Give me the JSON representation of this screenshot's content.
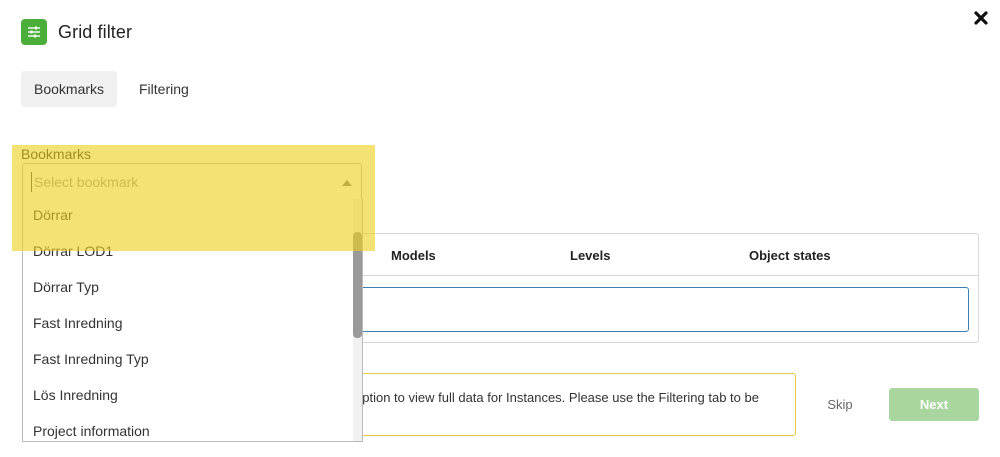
{
  "dialog": {
    "title": "Grid filter",
    "header_icon": "sliders-icon",
    "close_icon": "close-icon"
  },
  "tabs": [
    {
      "label": "Bookmarks",
      "active": true
    },
    {
      "label": "Filtering",
      "active": false
    }
  ],
  "bookmarks": {
    "label": "Bookmarks",
    "placeholder": "Select bookmark",
    "options": [
      "Dörrar",
      "Dörrar LOD1",
      "Dörrar Typ",
      "Fast Inredning",
      "Fast Inredning Typ",
      "Lös Inredning",
      "Project information"
    ]
  },
  "grid": {
    "columns": [
      "Models",
      "Levels",
      "Object states"
    ]
  },
  "notice": {
    "text": "option to view full data for Instances. Please use the Filtering tab to be"
  },
  "actions": {
    "skip_label": "Skip",
    "next_label": "Next"
  },
  "colors": {
    "accent_green": "#4cae3a",
    "next_disabled": "#a8d69e",
    "highlight": "#eed21e",
    "notice_border": "#e6c84a",
    "input_focus": "#3d7fb5"
  }
}
